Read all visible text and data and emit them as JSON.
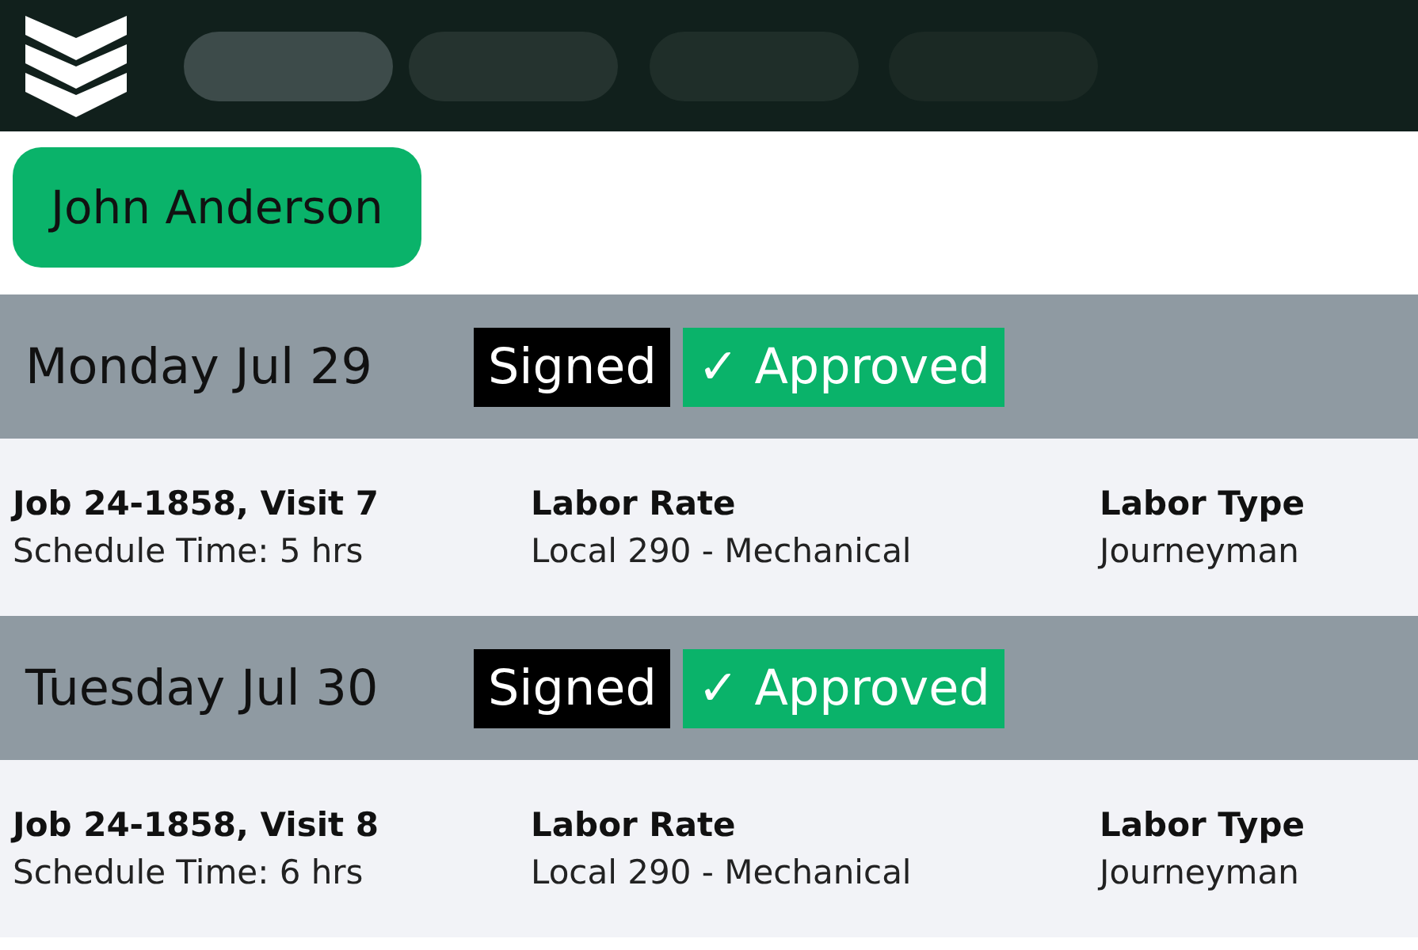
{
  "employee": {
    "name": "John Anderson"
  },
  "days": [
    {
      "date": "Monday Jul 29",
      "badges": [
        {
          "kind": "signed",
          "label": "Signed"
        },
        {
          "kind": "approved",
          "label": "✓ Approved"
        }
      ],
      "job": {
        "title": "Job 24-1858, Visit 7",
        "schedule": "Schedule Time: 5 hrs",
        "rate_label": "Labor Rate",
        "rate": "Local 290 - Mechanical",
        "type_label": "Labor Type",
        "type": "Journeyman"
      }
    },
    {
      "date": "Tuesday Jul 30",
      "badges": [
        {
          "kind": "signed",
          "label": "Signed"
        },
        {
          "kind": "approved",
          "label": "✓ Approved"
        }
      ],
      "job": {
        "title": "Job 24-1858, Visit 8",
        "schedule": "Schedule Time: 6 hrs",
        "rate_label": "Labor Rate",
        "rate": "Local 290 - Mechanical",
        "type_label": "Labor Type",
        "type": "Journeyman"
      }
    }
  ]
}
